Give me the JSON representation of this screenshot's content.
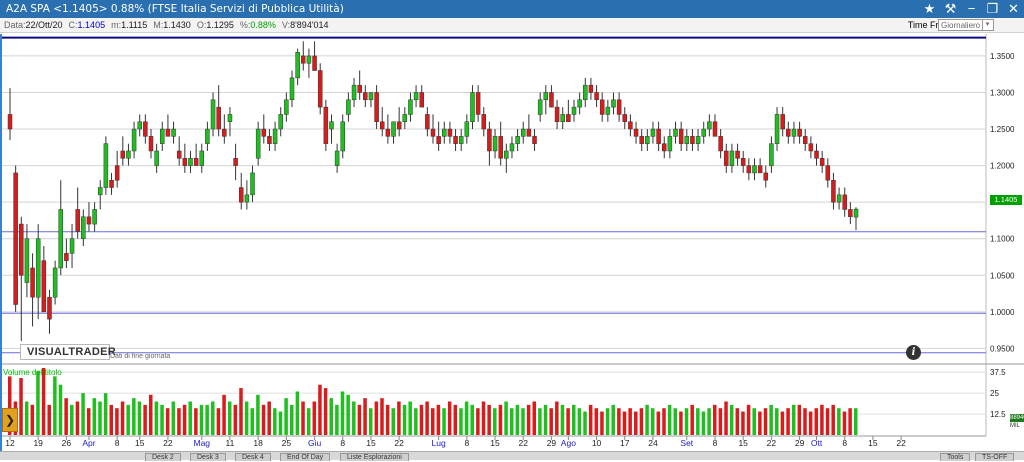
{
  "window": {
    "title": "A2A SPA <1.1405> 0.88%  (FTSE Italia Servizi di Pubblica Utilità)",
    "icons": [
      "star-icon",
      "tools-icon",
      "minimize-icon",
      "restore-icon",
      "close-icon"
    ]
  },
  "infobar": {
    "date_label": "Data:",
    "date": "22/Ott/20",
    "close_label": "C:",
    "close": "1.1405",
    "min_label": "m:",
    "min": "1.1115",
    "max_label": "M:",
    "max": "1.1430",
    "open_label": "O:",
    "open": "1.1295",
    "pct_label": "%:",
    "pct": "0.88%",
    "vol_label": "V:",
    "vol": "8'894'014",
    "timeframe_label": "Time Frame",
    "timeframe_value": "Giornaliero"
  },
  "price_panel": {
    "logo": "VISUALTRADER",
    "sublogo": "Dati di fine giornata",
    "last_badge": "1.1405"
  },
  "volume_panel": {
    "label": "Volume del titolo",
    "badge": "8894014",
    "unit": "MIL"
  },
  "bottom_tabs": [
    "Desk 2",
    "Desk 3",
    "Desk 4",
    "End Of Day",
    "Liste Esplorazioni"
  ],
  "bottom_right": [
    "Tools",
    "TS-OFF"
  ],
  "colors": {
    "up": "#1fbf1f",
    "down": "#d81c1c",
    "title_bg": "#2a6fb0"
  },
  "chart_data": {
    "type": "candlestick",
    "ylim": [
      0.93,
      1.38
    ],
    "yticks": [
      "1.3500",
      "1.3000",
      "1.2500",
      "1.2000",
      "1.1500",
      "1.1000",
      "1.0500",
      "1.0000",
      "0.9500"
    ],
    "horizontal_lines": [
      1.375,
      1.1095,
      0.998,
      0.944
    ],
    "volume_ticks": [
      "37.5",
      "25",
      "12.5"
    ],
    "volume_max": 40,
    "xlabels": [
      {
        "label": "12",
        "month": false,
        "idx": 0
      },
      {
        "label": "19",
        "month": false,
        "idx": 5
      },
      {
        "label": "26",
        "month": false,
        "idx": 10
      },
      {
        "label": "Apr",
        "month": true,
        "idx": 14
      },
      {
        "label": "8",
        "month": false,
        "idx": 19
      },
      {
        "label": "15",
        "month": false,
        "idx": 23
      },
      {
        "label": "22",
        "month": false,
        "idx": 28
      },
      {
        "label": "Mag",
        "month": true,
        "idx": 34
      },
      {
        "label": "11",
        "month": false,
        "idx": 39
      },
      {
        "label": "18",
        "month": false,
        "idx": 44
      },
      {
        "label": "25",
        "month": false,
        "idx": 49
      },
      {
        "label": "Giu",
        "month": true,
        "idx": 54
      },
      {
        "label": "8",
        "month": false,
        "idx": 59
      },
      {
        "label": "15",
        "month": false,
        "idx": 64
      },
      {
        "label": "22",
        "month": false,
        "idx": 69
      },
      {
        "label": "Lug",
        "month": true,
        "idx": 76
      },
      {
        "label": "8",
        "month": false,
        "idx": 81
      },
      {
        "label": "15",
        "month": false,
        "idx": 86
      },
      {
        "label": "22",
        "month": false,
        "idx": 91
      },
      {
        "label": "29",
        "month": false,
        "idx": 96
      },
      {
        "label": "Ago",
        "month": true,
        "idx": 99
      },
      {
        "label": "10",
        "month": false,
        "idx": 104
      },
      {
        "label": "17",
        "month": false,
        "idx": 109
      },
      {
        "label": "24",
        "month": false,
        "idx": 114
      },
      {
        "label": "Set",
        "month": true,
        "idx": 120
      },
      {
        "label": "8",
        "month": false,
        "idx": 125
      },
      {
        "label": "15",
        "month": false,
        "idx": 130
      },
      {
        "label": "22",
        "month": false,
        "idx": 135
      },
      {
        "label": "29",
        "month": false,
        "idx": 140
      },
      {
        "label": "Ott",
        "month": true,
        "idx": 143
      },
      {
        "label": "8",
        "month": false,
        "idx": 148
      },
      {
        "label": "15",
        "month": false,
        "idx": 153
      },
      {
        "label": "22",
        "month": false,
        "idx": 158
      }
    ],
    "candles": [
      [
        1.27,
        1.306,
        1.235,
        1.25
      ],
      [
        1.19,
        1.2,
        1.0,
        1.01
      ],
      [
        1.12,
        1.13,
        0.96,
        1.05
      ],
      [
        1.04,
        1.12,
        1.02,
        1.1
      ],
      [
        1.06,
        1.08,
        0.98,
        1.02
      ],
      [
        1.02,
        1.12,
        0.99,
        1.1
      ],
      [
        1.07,
        1.09,
        1.0,
        1.0
      ],
      [
        1.02,
        1.03,
        0.97,
        0.99
      ],
      [
        1.02,
        1.07,
        1.01,
        1.06
      ],
      [
        1.06,
        1.18,
        1.05,
        1.14
      ],
      [
        1.08,
        1.1,
        1.06,
        1.07
      ],
      [
        1.08,
        1.12,
        1.06,
        1.1
      ],
      [
        1.14,
        1.17,
        1.1,
        1.11
      ],
      [
        1.1,
        1.14,
        1.09,
        1.13
      ],
      [
        1.13,
        1.15,
        1.11,
        1.12
      ],
      [
        1.12,
        1.15,
        1.11,
        1.14
      ],
      [
        1.16,
        1.18,
        1.14,
        1.17
      ],
      [
        1.17,
        1.24,
        1.16,
        1.23
      ],
      [
        1.18,
        1.19,
        1.16,
        1.17
      ],
      [
        1.2,
        1.22,
        1.17,
        1.18
      ],
      [
        1.22,
        1.24,
        1.2,
        1.21
      ],
      [
        1.21,
        1.23,
        1.2,
        1.22
      ],
      [
        1.22,
        1.26,
        1.21,
        1.25
      ],
      [
        1.25,
        1.27,
        1.24,
        1.26
      ],
      [
        1.26,
        1.27,
        1.23,
        1.24
      ],
      [
        1.24,
        1.25,
        1.21,
        1.22
      ],
      [
        1.2,
        1.23,
        1.19,
        1.22
      ],
      [
        1.23,
        1.26,
        1.22,
        1.25
      ],
      [
        1.25,
        1.27,
        1.24,
        1.24
      ],
      [
        1.24,
        1.26,
        1.23,
        1.25
      ],
      [
        1.22,
        1.24,
        1.2,
        1.21
      ],
      [
        1.21,
        1.23,
        1.19,
        1.2
      ],
      [
        1.2,
        1.22,
        1.19,
        1.21
      ],
      [
        1.21,
        1.23,
        1.2,
        1.2
      ],
      [
        1.2,
        1.23,
        1.19,
        1.22
      ],
      [
        1.23,
        1.26,
        1.22,
        1.25
      ],
      [
        1.25,
        1.3,
        1.24,
        1.29
      ],
      [
        1.28,
        1.31,
        1.24,
        1.25
      ],
      [
        1.25,
        1.27,
        1.23,
        1.24
      ],
      [
        1.26,
        1.28,
        1.24,
        1.27
      ],
      [
        1.21,
        1.23,
        1.18,
        1.2
      ],
      [
        1.17,
        1.19,
        1.14,
        1.15
      ],
      [
        1.15,
        1.18,
        1.14,
        1.16
      ],
      [
        1.16,
        1.2,
        1.15,
        1.19
      ],
      [
        1.21,
        1.26,
        1.2,
        1.25
      ],
      [
        1.25,
        1.27,
        1.23,
        1.24
      ],
      [
        1.24,
        1.25,
        1.22,
        1.23
      ],
      [
        1.23,
        1.26,
        1.22,
        1.25
      ],
      [
        1.25,
        1.28,
        1.24,
        1.27
      ],
      [
        1.27,
        1.3,
        1.26,
        1.29
      ],
      [
        1.29,
        1.33,
        1.28,
        1.32
      ],
      [
        1.32,
        1.36,
        1.31,
        1.355
      ],
      [
        1.35,
        1.37,
        1.33,
        1.34
      ],
      [
        1.34,
        1.36,
        1.32,
        1.35
      ],
      [
        1.35,
        1.37,
        1.33,
        1.33
      ],
      [
        1.33,
        1.34,
        1.27,
        1.28
      ],
      [
        1.28,
        1.29,
        1.22,
        1.23
      ],
      [
        1.25,
        1.27,
        1.23,
        1.26
      ],
      [
        1.2,
        1.23,
        1.19,
        1.22
      ],
      [
        1.22,
        1.27,
        1.21,
        1.26
      ],
      [
        1.27,
        1.3,
        1.26,
        1.29
      ],
      [
        1.29,
        1.32,
        1.28,
        1.31
      ],
      [
        1.31,
        1.33,
        1.29,
        1.3
      ],
      [
        1.3,
        1.31,
        1.28,
        1.29
      ],
      [
        1.29,
        1.3,
        1.28,
        1.3
      ],
      [
        1.3,
        1.31,
        1.25,
        1.26
      ],
      [
        1.26,
        1.28,
        1.24,
        1.25
      ],
      [
        1.25,
        1.27,
        1.23,
        1.24
      ],
      [
        1.24,
        1.26,
        1.23,
        1.26
      ],
      [
        1.26,
        1.28,
        1.24,
        1.25
      ],
      [
        1.26,
        1.28,
        1.25,
        1.27
      ],
      [
        1.27,
        1.3,
        1.26,
        1.29
      ],
      [
        1.29,
        1.31,
        1.28,
        1.3
      ],
      [
        1.3,
        1.31,
        1.28,
        1.28
      ],
      [
        1.27,
        1.28,
        1.24,
        1.25
      ],
      [
        1.25,
        1.27,
        1.23,
        1.24
      ],
      [
        1.24,
        1.26,
        1.22,
        1.23
      ],
      [
        1.24,
        1.26,
        1.23,
        1.25
      ],
      [
        1.25,
        1.26,
        1.23,
        1.24
      ],
      [
        1.24,
        1.25,
        1.22,
        1.23
      ],
      [
        1.23,
        1.25,
        1.22,
        1.24
      ],
      [
        1.24,
        1.27,
        1.23,
        1.26
      ],
      [
        1.26,
        1.31,
        1.25,
        1.3
      ],
      [
        1.3,
        1.31,
        1.26,
        1.27
      ],
      [
        1.27,
        1.28,
        1.24,
        1.25
      ],
      [
        1.25,
        1.26,
        1.2,
        1.22
      ],
      [
        1.22,
        1.25,
        1.21,
        1.24
      ],
      [
        1.24,
        1.26,
        1.2,
        1.21
      ],
      [
        1.21,
        1.23,
        1.19,
        1.22
      ],
      [
        1.22,
        1.24,
        1.21,
        1.23
      ],
      [
        1.23,
        1.25,
        1.22,
        1.24
      ],
      [
        1.24,
        1.26,
        1.23,
        1.25
      ],
      [
        1.25,
        1.27,
        1.24,
        1.24
      ],
      [
        1.24,
        1.25,
        1.22,
        1.23
      ],
      [
        1.27,
        1.3,
        1.26,
        1.29
      ],
      [
        1.29,
        1.31,
        1.27,
        1.3
      ],
      [
        1.3,
        1.31,
        1.28,
        1.28
      ],
      [
        1.28,
        1.29,
        1.25,
        1.26
      ],
      [
        1.26,
        1.28,
        1.25,
        1.27
      ],
      [
        1.27,
        1.29,
        1.26,
        1.26
      ],
      [
        1.27,
        1.29,
        1.26,
        1.28
      ],
      [
        1.28,
        1.3,
        1.27,
        1.29
      ],
      [
        1.29,
        1.32,
        1.28,
        1.31
      ],
      [
        1.31,
        1.32,
        1.29,
        1.3
      ],
      [
        1.3,
        1.31,
        1.28,
        1.29
      ],
      [
        1.29,
        1.3,
        1.26,
        1.27
      ],
      [
        1.27,
        1.29,
        1.26,
        1.28
      ],
      [
        1.28,
        1.3,
        1.27,
        1.29
      ],
      [
        1.29,
        1.3,
        1.26,
        1.27
      ],
      [
        1.27,
        1.28,
        1.25,
        1.26
      ],
      [
        1.26,
        1.27,
        1.24,
        1.25
      ],
      [
        1.25,
        1.26,
        1.23,
        1.24
      ],
      [
        1.24,
        1.25,
        1.22,
        1.23
      ],
      [
        1.23,
        1.25,
        1.22,
        1.24
      ],
      [
        1.24,
        1.26,
        1.23,
        1.25
      ],
      [
        1.25,
        1.26,
        1.22,
        1.23
      ],
      [
        1.23,
        1.24,
        1.21,
        1.22
      ],
      [
        1.22,
        1.25,
        1.21,
        1.24
      ],
      [
        1.24,
        1.26,
        1.23,
        1.25
      ],
      [
        1.25,
        1.26,
        1.22,
        1.23
      ],
      [
        1.23,
        1.25,
        1.22,
        1.24
      ],
      [
        1.24,
        1.25,
        1.22,
        1.23
      ],
      [
        1.23,
        1.25,
        1.22,
        1.24
      ],
      [
        1.24,
        1.26,
        1.23,
        1.25
      ],
      [
        1.25,
        1.27,
        1.24,
        1.26
      ],
      [
        1.26,
        1.27,
        1.24,
        1.24
      ],
      [
        1.24,
        1.25,
        1.21,
        1.22
      ],
      [
        1.22,
        1.23,
        1.19,
        1.2
      ],
      [
        1.2,
        1.23,
        1.19,
        1.22
      ],
      [
        1.22,
        1.23,
        1.2,
        1.21
      ],
      [
        1.21,
        1.22,
        1.19,
        1.2
      ],
      [
        1.2,
        1.21,
        1.18,
        1.19
      ],
      [
        1.19,
        1.21,
        1.18,
        1.2
      ],
      [
        1.2,
        1.21,
        1.19,
        1.19
      ],
      [
        1.19,
        1.2,
        1.17,
        1.18
      ],
      [
        1.2,
        1.24,
        1.19,
        1.23
      ],
      [
        1.23,
        1.28,
        1.22,
        1.27
      ],
      [
        1.27,
        1.28,
        1.24,
        1.25
      ],
      [
        1.25,
        1.26,
        1.23,
        1.24
      ],
      [
        1.24,
        1.26,
        1.23,
        1.25
      ],
      [
        1.25,
        1.26,
        1.23,
        1.24
      ],
      [
        1.24,
        1.25,
        1.22,
        1.23
      ],
      [
        1.23,
        1.24,
        1.21,
        1.22
      ],
      [
        1.22,
        1.23,
        1.2,
        1.21
      ],
      [
        1.21,
        1.22,
        1.19,
        1.2
      ],
      [
        1.2,
        1.21,
        1.17,
        1.18
      ],
      [
        1.18,
        1.19,
        1.14,
        1.15
      ],
      [
        1.15,
        1.17,
        1.14,
        1.16
      ],
      [
        1.16,
        1.17,
        1.13,
        1.14
      ],
      [
        1.14,
        1.15,
        1.12,
        1.13
      ],
      [
        1.1295,
        1.143,
        1.1115,
        1.1405
      ]
    ],
    "volumes": [
      35,
      20,
      34,
      20,
      18,
      38,
      40,
      18,
      35,
      30,
      22,
      18,
      20,
      25,
      16,
      22,
      20,
      25,
      18,
      16,
      20,
      18,
      22,
      20,
      18,
      24,
      20,
      18,
      16,
      20,
      16,
      18,
      20,
      16,
      18,
      18,
      20,
      16,
      24,
      20,
      18,
      28,
      20,
      16,
      24,
      18,
      20,
      16,
      14,
      22,
      18,
      26,
      20,
      16,
      20,
      30,
      28,
      22,
      18,
      26,
      24,
      20,
      18,
      22,
      16,
      20,
      22,
      18,
      16,
      20,
      18,
      20,
      16,
      18,
      20,
      16,
      18,
      16,
      20,
      18,
      16,
      20,
      18,
      16,
      20,
      18,
      16,
      18,
      20,
      16,
      18,
      16,
      18,
      20,
      16,
      18,
      16,
      20,
      18,
      16,
      18,
      16,
      14,
      18,
      16,
      14,
      16,
      18,
      16,
      14,
      16,
      14,
      16,
      18,
      16,
      14,
      16,
      18,
      16,
      14,
      16,
      18,
      16,
      14,
      16,
      18,
      16,
      20,
      18,
      16,
      14,
      18,
      16,
      14,
      16,
      18,
      16,
      14,
      16,
      18,
      18,
      16,
      14,
      16,
      18,
      16,
      18,
      16,
      14,
      16,
      16,
      18,
      16,
      14,
      16,
      18,
      16,
      14,
      16,
      18,
      16,
      18,
      16,
      14,
      16
    ]
  }
}
